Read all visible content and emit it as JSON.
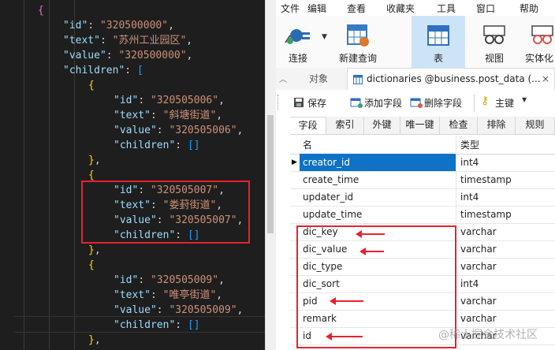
{
  "editor": {
    "lines": [
      [
        {
          "t": "{",
          "c": "brk2"
        }
      ],
      [
        {
          "t": "\"id\"",
          "c": "key"
        },
        {
          "t": ": ",
          "c": "punc"
        },
        {
          "t": "\"320500000\"",
          "c": "str"
        },
        {
          "t": ",",
          "c": "punc"
        }
      ],
      [
        {
          "t": "\"text\"",
          "c": "key"
        },
        {
          "t": ": ",
          "c": "punc"
        },
        {
          "t": "\"苏州工业园区\"",
          "c": "str"
        },
        {
          "t": ",",
          "c": "punc"
        }
      ],
      [
        {
          "t": "\"value\"",
          "c": "key"
        },
        {
          "t": ": ",
          "c": "punc"
        },
        {
          "t": "\"320500000\"",
          "c": "str"
        },
        {
          "t": ",",
          "c": "punc"
        }
      ],
      [
        {
          "t": "\"children\"",
          "c": "key"
        },
        {
          "t": ": ",
          "c": "punc"
        },
        {
          "t": "[",
          "c": "brk3"
        }
      ],
      [
        {
          "t": "{",
          "c": "brk"
        }
      ],
      [
        {
          "t": "\"id\"",
          "c": "key"
        },
        {
          "t": ": ",
          "c": "punc"
        },
        {
          "t": "\"320505006\"",
          "c": "str"
        },
        {
          "t": ",",
          "c": "punc"
        }
      ],
      [
        {
          "t": "\"text\"",
          "c": "key"
        },
        {
          "t": ": ",
          "c": "punc"
        },
        {
          "t": "\"斜塘街道\"",
          "c": "str"
        },
        {
          "t": ",",
          "c": "punc"
        }
      ],
      [
        {
          "t": "\"value\"",
          "c": "key"
        },
        {
          "t": ": ",
          "c": "punc"
        },
        {
          "t": "\"320505006\"",
          "c": "str"
        },
        {
          "t": ",",
          "c": "punc"
        }
      ],
      [
        {
          "t": "\"children\"",
          "c": "key"
        },
        {
          "t": ": ",
          "c": "punc"
        },
        {
          "t": "[]",
          "c": "brk3"
        }
      ],
      [
        {
          "t": "}",
          "c": "brk"
        },
        {
          "t": ",",
          "c": "punc"
        }
      ],
      [
        {
          "t": "{",
          "c": "brk"
        }
      ],
      [
        {
          "t": "\"id\"",
          "c": "key"
        },
        {
          "t": ": ",
          "c": "punc"
        },
        {
          "t": "\"320505007\"",
          "c": "str"
        },
        {
          "t": ",",
          "c": "punc"
        }
      ],
      [
        {
          "t": "\"text\"",
          "c": "key"
        },
        {
          "t": ": ",
          "c": "punc"
        },
        {
          "t": "\"娄葑街道\"",
          "c": "str"
        },
        {
          "t": ",",
          "c": "punc"
        }
      ],
      [
        {
          "t": "\"value\"",
          "c": "key"
        },
        {
          "t": ": ",
          "c": "punc"
        },
        {
          "t": "\"320505007\"",
          "c": "str"
        },
        {
          "t": ",",
          "c": "punc"
        }
      ],
      [
        {
          "t": "\"children\"",
          "c": "key"
        },
        {
          "t": ": ",
          "c": "punc"
        },
        {
          "t": "[]",
          "c": "brk3"
        }
      ],
      [
        {
          "t": "}",
          "c": "brk"
        },
        {
          "t": ",",
          "c": "punc"
        }
      ],
      [
        {
          "t": "{",
          "c": "brk"
        }
      ],
      [
        {
          "t": "\"id\"",
          "c": "key"
        },
        {
          "t": ": ",
          "c": "punc"
        },
        {
          "t": "\"320505009\"",
          "c": "str"
        },
        {
          "t": ",",
          "c": "punc"
        }
      ],
      [
        {
          "t": "\"text\"",
          "c": "key"
        },
        {
          "t": ": ",
          "c": "punc"
        },
        {
          "t": "\"唯亭街道\"",
          "c": "str"
        },
        {
          "t": ",",
          "c": "punc"
        }
      ],
      [
        {
          "t": "\"value\"",
          "c": "key"
        },
        {
          "t": ": ",
          "c": "punc"
        },
        {
          "t": "\"320505009\"",
          "c": "str"
        },
        {
          "t": ",",
          "c": "punc"
        }
      ],
      [
        {
          "t": "\"children\"",
          "c": "key"
        },
        {
          "t": ": ",
          "c": "punc"
        },
        {
          "t": "[]",
          "c": "brk3"
        }
      ],
      [
        {
          "t": "}",
          "c": "brk"
        },
        {
          "t": ",",
          "c": "punc"
        }
      ]
    ]
  },
  "menubar": {
    "items": [
      "文件",
      "编辑",
      "查看",
      "收藏夹",
      "工具",
      "窗口",
      "帮助"
    ]
  },
  "toolbar": {
    "connect": "连接",
    "new_query": "新建查询",
    "table": "表",
    "view": "视图",
    "entity": "实体化"
  },
  "tabs": {
    "objects": "对象",
    "active_title": "dictionaries @business.post_data (..."
  },
  "design_toolbar": {
    "save": "保存",
    "add_field": "添加字段",
    "delete_field": "删除字段",
    "primary_key": "主键"
  },
  "subtabs": [
    "字段",
    "索引",
    "外键",
    "唯一键",
    "检查",
    "排除",
    "规则"
  ],
  "grid": {
    "header_name": "名",
    "header_type": "类型",
    "rows": [
      {
        "name": "creator_id",
        "type": "int4"
      },
      {
        "name": "create_time",
        "type": "timestamp"
      },
      {
        "name": "updater_id",
        "type": "int4"
      },
      {
        "name": "update_time",
        "type": "timestamp"
      },
      {
        "name": "dic_key",
        "type": "varchar"
      },
      {
        "name": "dic_value",
        "type": "varchar"
      },
      {
        "name": "dic_type",
        "type": "varchar"
      },
      {
        "name": "dic_sort",
        "type": "int4"
      },
      {
        "name": "pid",
        "type": "varchar"
      },
      {
        "name": "remark",
        "type": "varchar"
      },
      {
        "name": "id",
        "type": "varchar"
      }
    ]
  },
  "watermark": "@稀土掘金技术社区",
  "colors": {
    "annotation": "#e8222f",
    "selection": "#0e72c6",
    "active_tool": "#cde4f7"
  }
}
